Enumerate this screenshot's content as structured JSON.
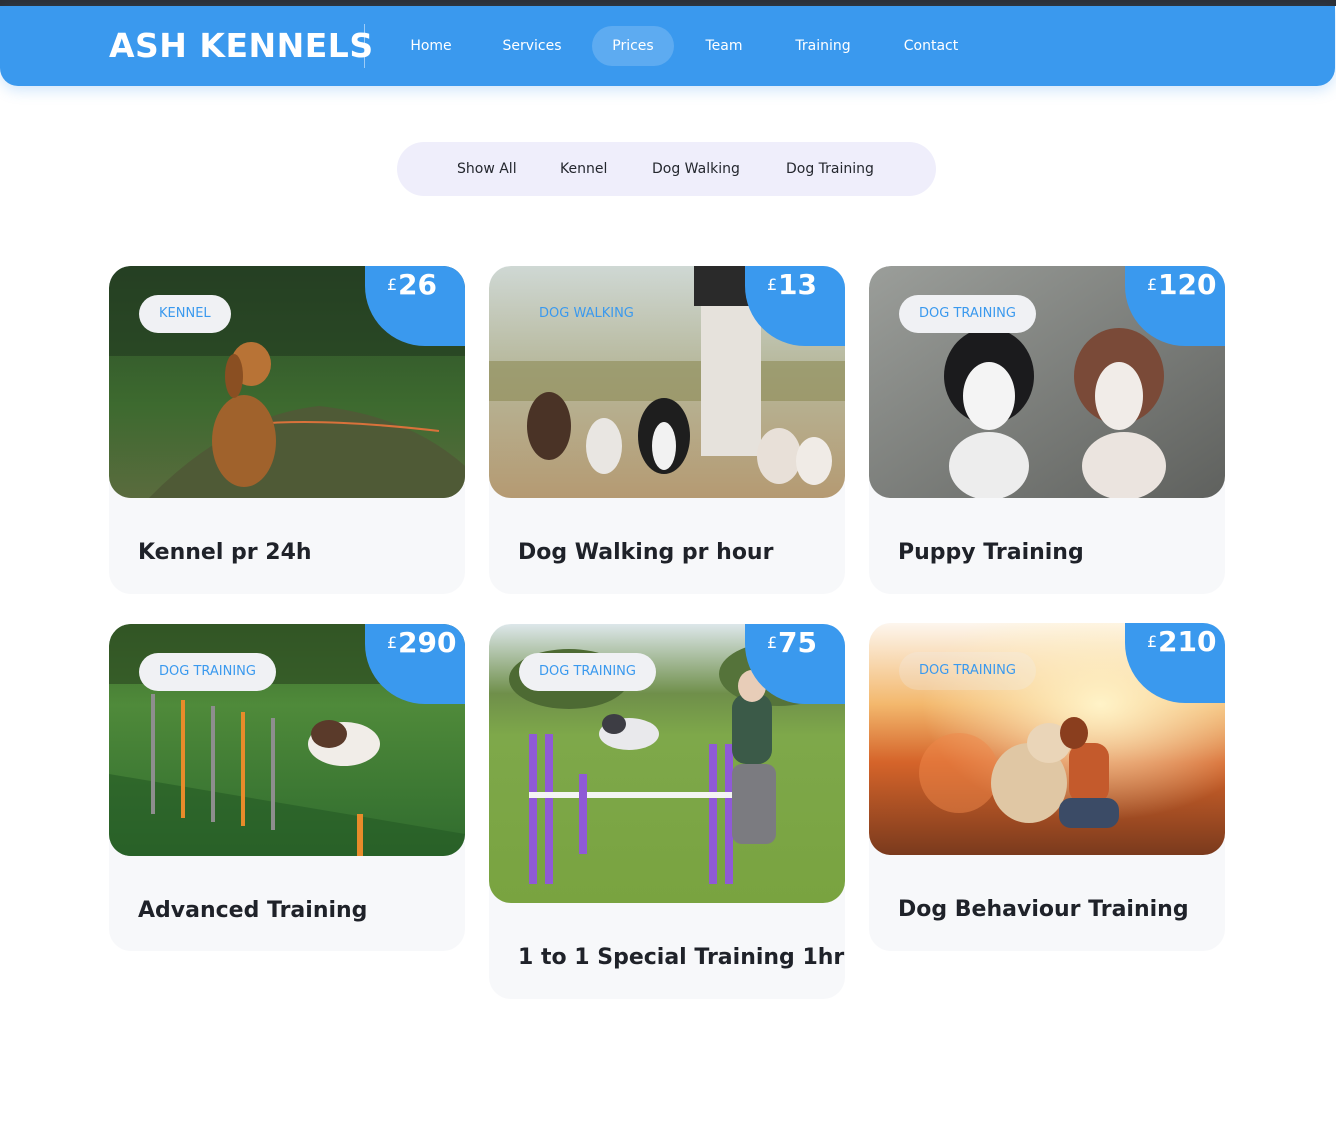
{
  "header": {
    "brand": "ASH KENNELS",
    "nav": [
      {
        "label": "Home",
        "active": false
      },
      {
        "label": "Services",
        "active": false
      },
      {
        "label": "Prices",
        "active": true
      },
      {
        "label": "Team",
        "active": false
      },
      {
        "label": "Training",
        "active": false
      },
      {
        "label": "Contact",
        "active": false
      }
    ]
  },
  "filters": [
    "Show All",
    "Kennel",
    "Dog Walking",
    "Dog Training"
  ],
  "currency_symbol": "£",
  "cards": [
    {
      "category": "KENNEL",
      "price": "26",
      "title": "Kennel pr 24h",
      "image": "spaniel-in-forest-photo"
    },
    {
      "category": "DOG WALKING",
      "price": "13",
      "title": "Dog Walking pr hour",
      "image": "dog-walker-with-pack-photo"
    },
    {
      "category": "DOG TRAINING",
      "price": "120",
      "title": "Puppy Training",
      "image": "border-collie-puppies-photo"
    },
    {
      "category": "DOG TRAINING",
      "price": "290",
      "title": "Advanced Training",
      "image": "agility-weave-poles-photo"
    },
    {
      "category": "DOG TRAINING",
      "price": "75",
      "title": "1 to 1 Special Training 1hr",
      "image": "agility-jump-photo"
    },
    {
      "category": "DOG TRAINING",
      "price": "210",
      "title": "Dog Behaviour Training",
      "image": "sunset-woman-with-dog-photo"
    }
  ],
  "colors": {
    "accent": "#3a99ee",
    "filter_bg": "#efeefb",
    "card_bg": "#f7f8fa",
    "chip_bg": "#f0f1f4"
  }
}
